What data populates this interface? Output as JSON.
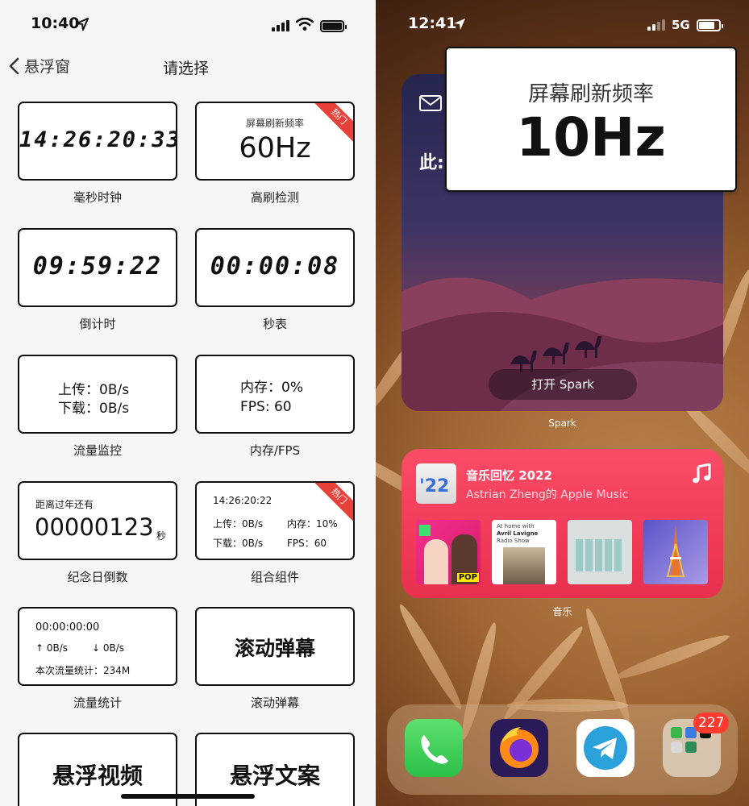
{
  "left": {
    "status": {
      "time": "10:40"
    },
    "nav": {
      "back_label": "悬浮窗",
      "title": "请选择"
    },
    "widgets": [
      {
        "id": "ms-clock",
        "display": "14:26:20:33",
        "caption": "毫秒时钟"
      },
      {
        "id": "refresh-detect",
        "small_label": "屏幕刷新频率",
        "display": "60Hz",
        "badge": "热门",
        "caption": "高刷检测"
      },
      {
        "id": "countdown",
        "display": "09:59:22",
        "caption": "倒计时"
      },
      {
        "id": "stopwatch",
        "display": "00:00:08",
        "caption": "秒表"
      },
      {
        "id": "traffic-monitor",
        "line1": "上传：0B/s",
        "line2": "下载：0B/s",
        "caption": "流量监控"
      },
      {
        "id": "mem-fps",
        "line1": "内存：0%",
        "line2": "FPS: 60",
        "caption": "内存/FPS"
      },
      {
        "id": "anniversary",
        "small_label": "距离过年还有",
        "display": "00000123",
        "unit": "秒",
        "caption": "纪念日倒数"
      },
      {
        "id": "combo",
        "time": "14:26:20:22",
        "upload": "上传：0B/s",
        "memory": "内存：10%",
        "download": "下载：0B/s",
        "fps": "FPS：60",
        "badge": "热门",
        "caption": "组合组件"
      },
      {
        "id": "traffic-stats",
        "time": "00:00:00:00",
        "up": "↑  0B/s",
        "down": "↓  0B/s",
        "total": "本次流量统计：234M",
        "caption": "流量统计"
      },
      {
        "id": "danmaku",
        "display": "滚动弹幕",
        "caption": "滚动弹幕"
      },
      {
        "id": "float-video",
        "display": "悬浮视频"
      },
      {
        "id": "float-text",
        "display": "悬浮文案"
      }
    ]
  },
  "right": {
    "status": {
      "time": "12:41",
      "network": "5G"
    },
    "refresh_overlay": {
      "label": "屏幕刷新频率",
      "value": "10Hz"
    },
    "spark": {
      "partial_text": "此:",
      "open_button": "打开 Spark",
      "app_label": "Spark"
    },
    "music": {
      "badge_text": "'22",
      "title": "音乐回忆 2022",
      "subtitle": "Astrian Zheng的 Apple Music",
      "app_label": "音乐",
      "album1": {
        "line": "POP"
      },
      "album2": {
        "line1": "At home with",
        "line2": "Avril Lavigne",
        "line3": "Radio Show"
      }
    },
    "folder_badge": "227"
  },
  "colors": {
    "ribbon": "#e8413a",
    "music": "#f23d5a",
    "phone_green": "#34c759",
    "telegram": "#2aa1da"
  }
}
